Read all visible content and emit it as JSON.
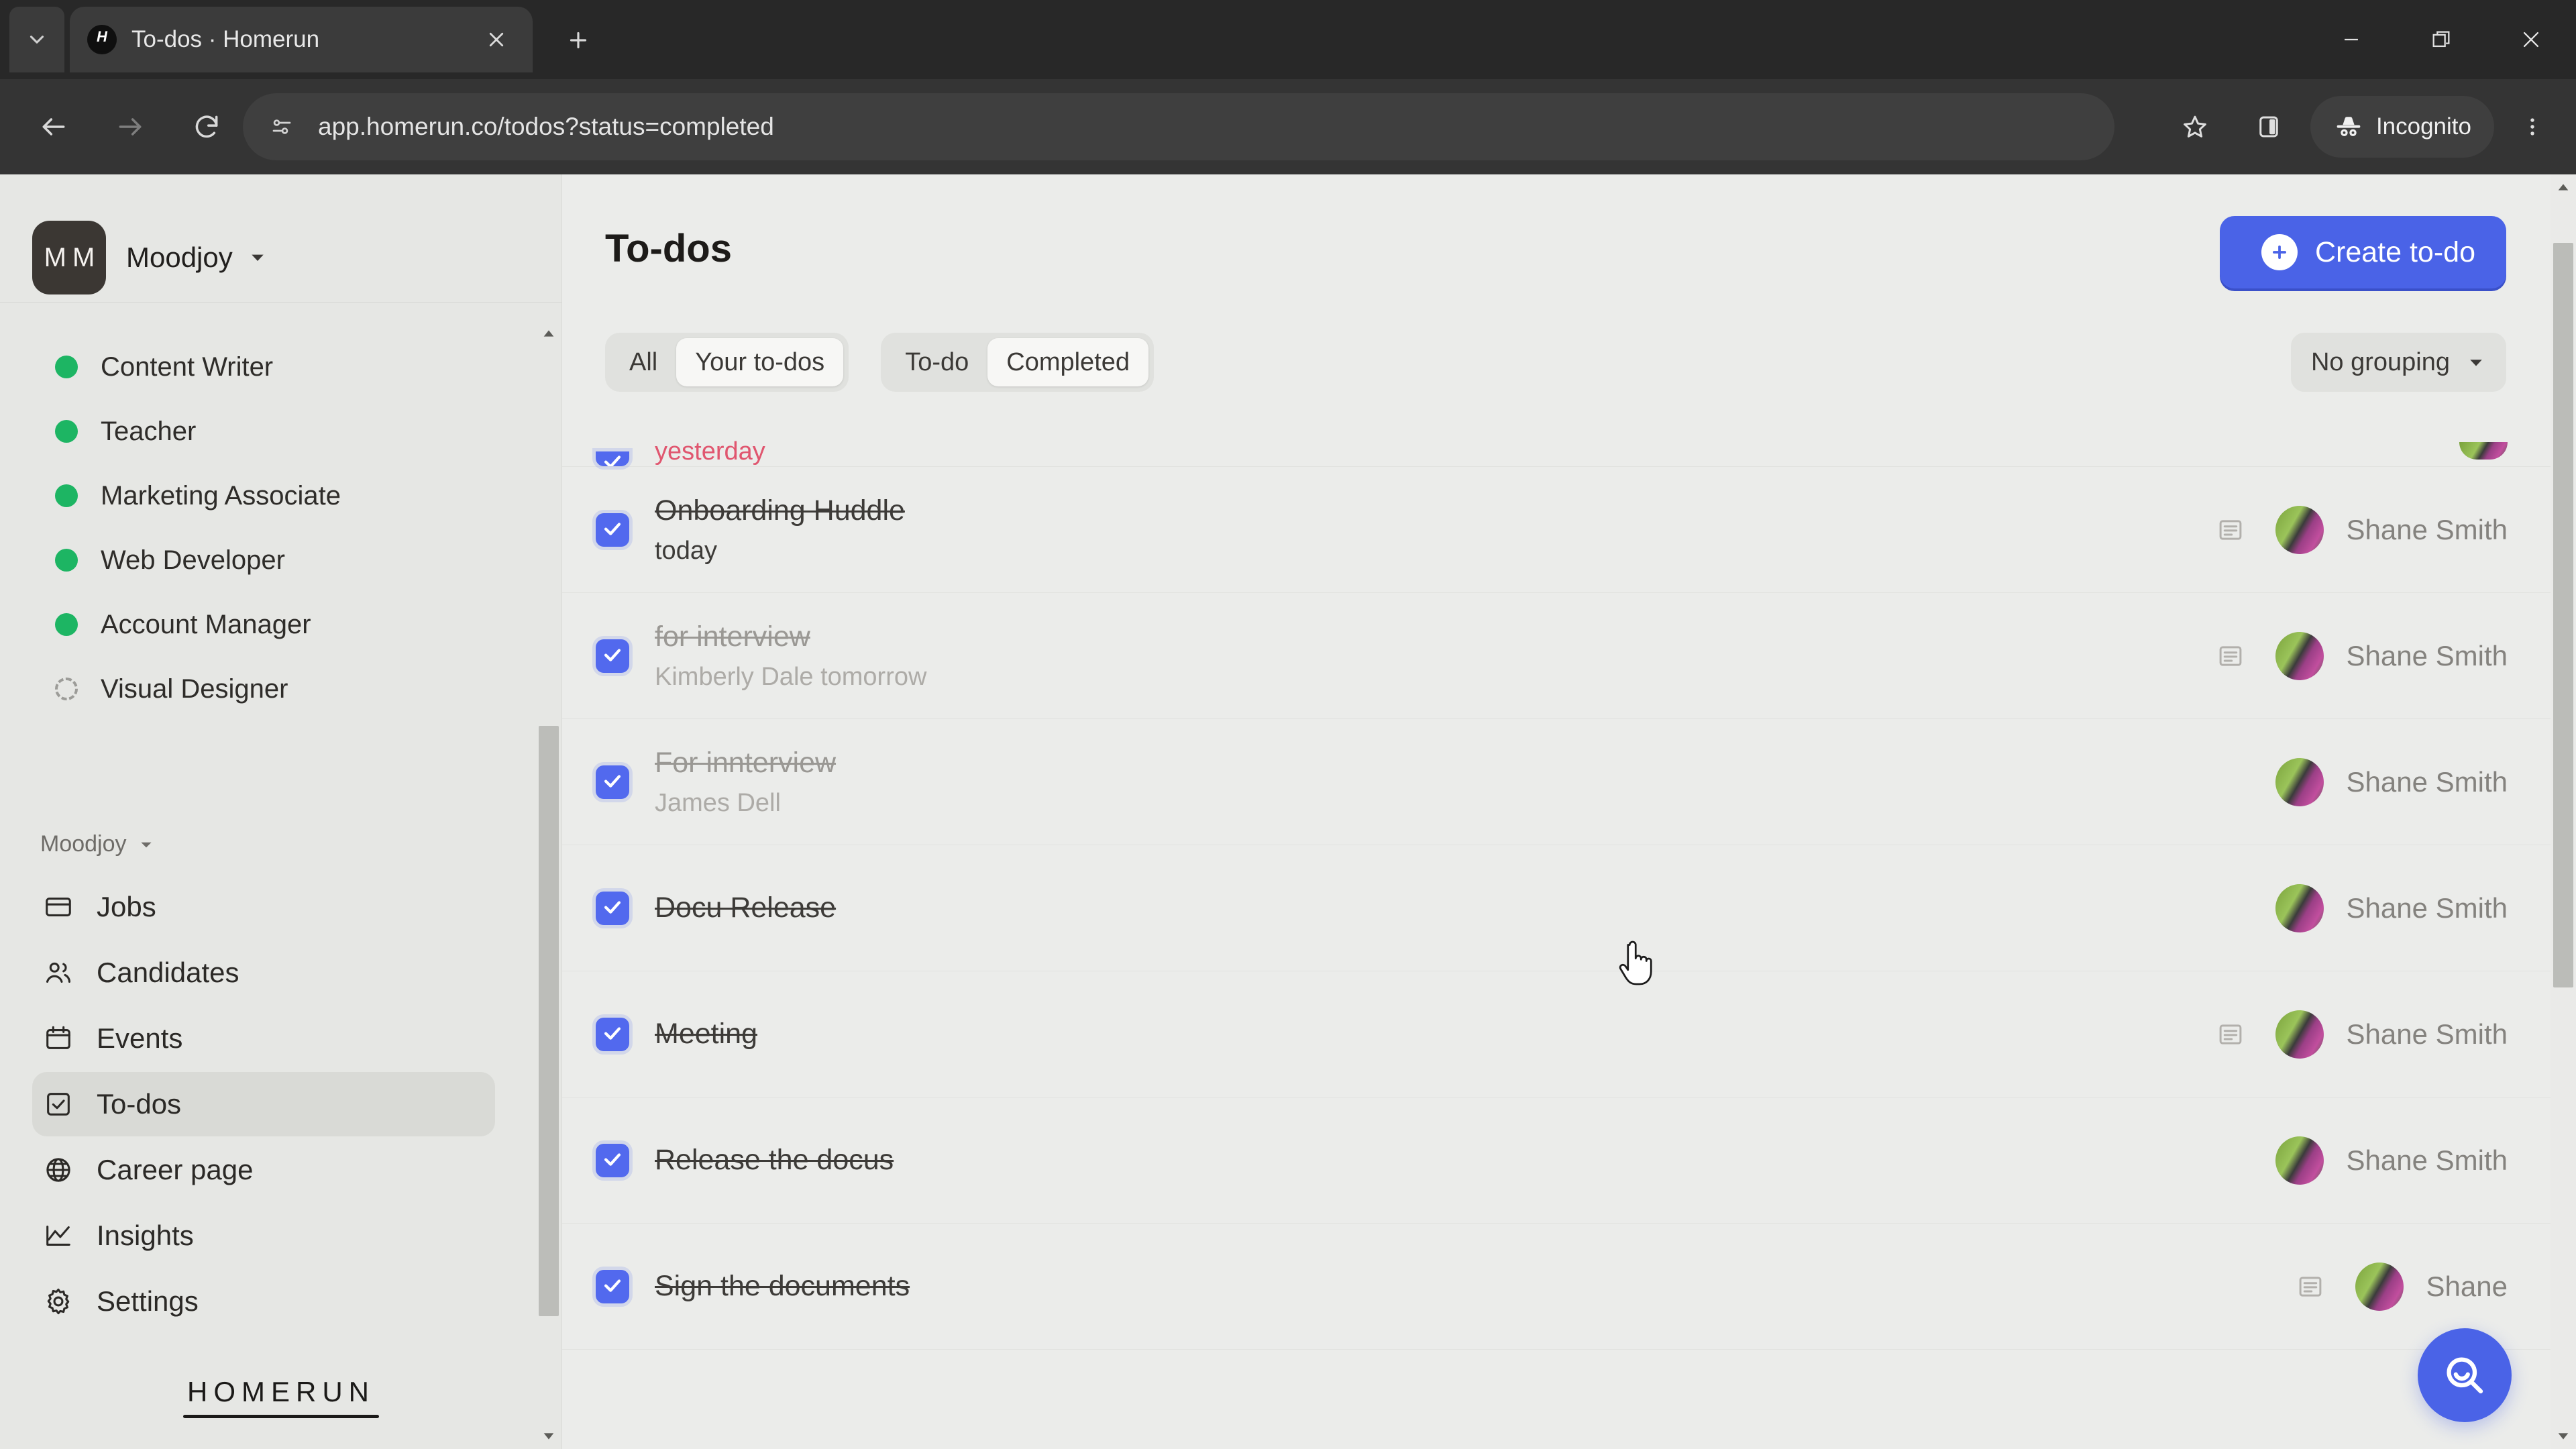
{
  "browser": {
    "tab": {
      "title": "To-dos · Homerun",
      "favicon_letter": "H",
      "favicon_name": "homerun-favicon"
    },
    "tab_dropdown_label": "Search tabs",
    "new_tab_label": "New tab",
    "close_tab_label": "Close",
    "url": "app.homerun.co/todos?status=completed",
    "profile_label": "Incognito",
    "window_controls": {
      "minimize": "Minimize",
      "maximize": "Maximize",
      "close": "Close"
    },
    "icons": {
      "back": "back-arrow-icon",
      "forward": "forward-arrow-icon",
      "reload": "reload-icon",
      "site_info": "site-settings-icon",
      "bookmark": "star-icon",
      "side_panel": "side-panel-icon",
      "incognito": "incognito-hat-icon",
      "menu": "three-dot-menu-icon"
    }
  },
  "sidebar": {
    "workspace": {
      "initials": "M M",
      "name": "Moodjoy"
    },
    "jobs": [
      {
        "label": "Content Writer",
        "status": "published"
      },
      {
        "label": "Teacher",
        "status": "published"
      },
      {
        "label": "Marketing Associate",
        "status": "published"
      },
      {
        "label": "Web Developer",
        "status": "published"
      },
      {
        "label": "Account Manager",
        "status": "published"
      },
      {
        "label": "Visual Designer",
        "status": "draft"
      }
    ],
    "nav_group_label": "Moodjoy",
    "nav": [
      {
        "label": "Jobs",
        "icon": "briefcase-icon",
        "active": false
      },
      {
        "label": "Candidates",
        "icon": "people-icon",
        "active": false
      },
      {
        "label": "Events",
        "icon": "calendar-icon",
        "active": false
      },
      {
        "label": "To-dos",
        "icon": "checkbox-icon",
        "active": true
      },
      {
        "label": "Career page",
        "icon": "globe-icon",
        "active": false
      },
      {
        "label": "Insights",
        "icon": "chart-line-icon",
        "active": false
      },
      {
        "label": "Settings",
        "icon": "gear-icon",
        "active": false
      }
    ],
    "brand": "HOMERUN"
  },
  "main": {
    "title": "To-dos",
    "create_button": "Create to-do",
    "filters": {
      "scope": {
        "options": [
          "All",
          "Your to-dos"
        ],
        "selected": "Your to-dos"
      },
      "status": {
        "options": [
          "To-do",
          "Completed"
        ],
        "selected": "Completed"
      }
    },
    "grouping": {
      "label": "No grouping"
    },
    "todos": [
      {
        "title": "",
        "subtitle": "yesterday",
        "subtitle_style": "due-red",
        "completed": true,
        "assignee": "",
        "has_note": false,
        "partial": true
      },
      {
        "title": "Onboarding Huddle",
        "subtitle": "today",
        "subtitle_style": "normal",
        "completed": true,
        "assignee": "Shane Smith",
        "has_note": true,
        "partial": false
      },
      {
        "title": "for interview",
        "subtitle": "Kimberly Dale tomorrow",
        "subtitle_person": "Kimberly Dale",
        "subtitle_style": "muted",
        "completed": true,
        "assignee": "Shane Smith",
        "has_note": true,
        "partial": false
      },
      {
        "title": "For innterview",
        "subtitle": "James Dell",
        "subtitle_style": "muted",
        "completed": true,
        "assignee": "Shane Smith",
        "has_note": false,
        "partial": false
      },
      {
        "title": "Docu Release",
        "subtitle": "",
        "subtitle_style": "normal",
        "completed": true,
        "assignee": "Shane Smith",
        "has_note": false,
        "partial": false
      },
      {
        "title": "Meeting",
        "subtitle": "",
        "subtitle_style": "normal",
        "completed": true,
        "assignee": "Shane Smith",
        "has_note": true,
        "partial": false
      },
      {
        "title": "Release the docus",
        "subtitle": "",
        "subtitle_style": "normal",
        "completed": true,
        "assignee": "Shane Smith",
        "has_note": false,
        "partial": false
      },
      {
        "title": "Sign the documents",
        "subtitle": "",
        "subtitle_style": "normal",
        "completed": true,
        "assignee": "Shane",
        "has_note": true,
        "partial": false
      }
    ],
    "search_fab_label": "Search"
  },
  "colors": {
    "accent_blue": "#4a63e7",
    "checkbox_blue": "#5269ee",
    "job_published_green": "#1db563",
    "due_red": "#e0566f",
    "page_bg": "#ebecea",
    "sidebar_bg": "#e6e7e4"
  }
}
